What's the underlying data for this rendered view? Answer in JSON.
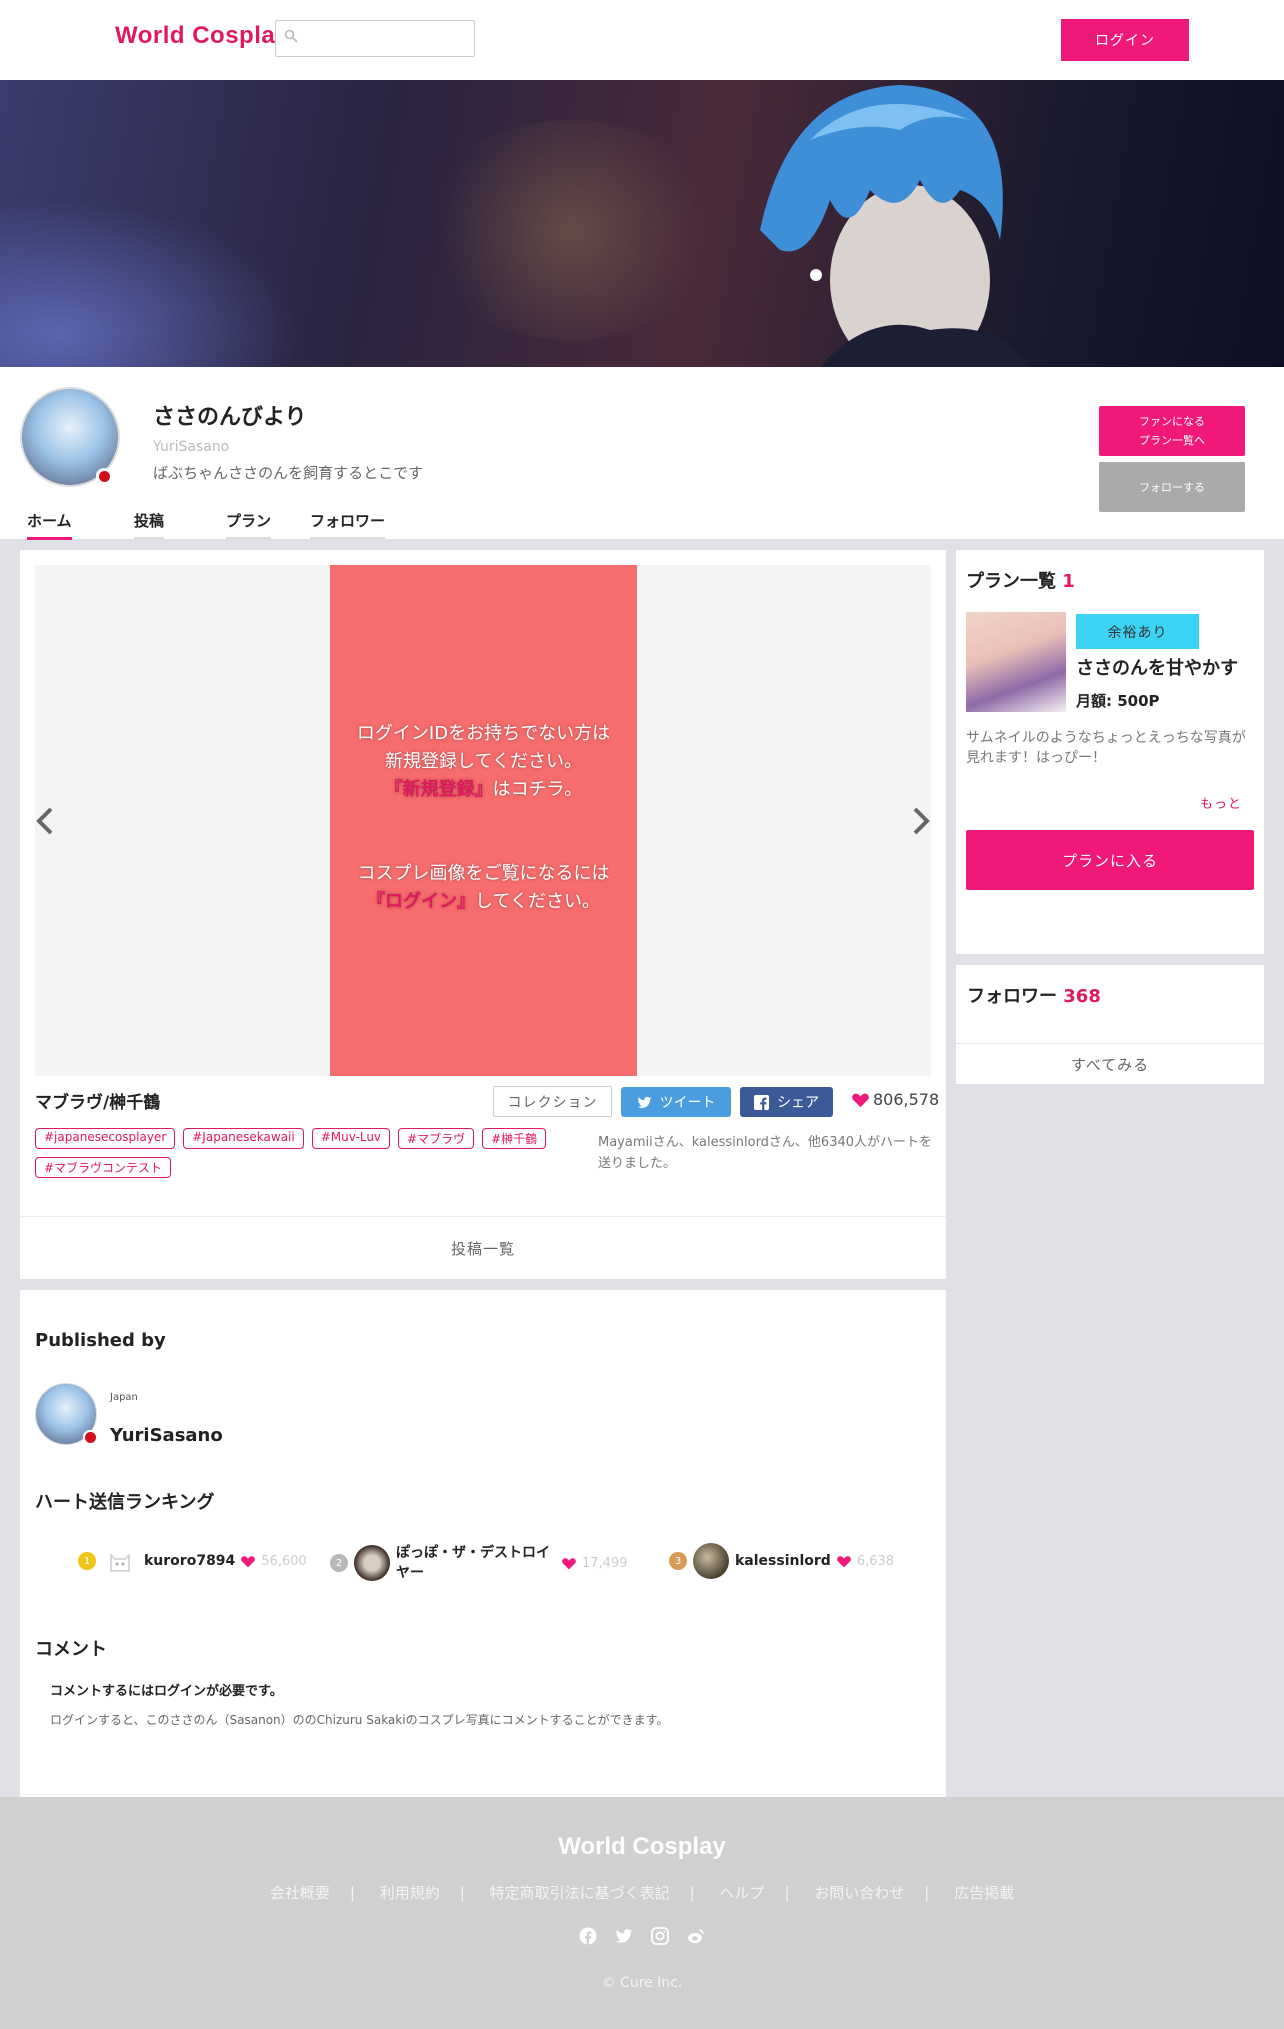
{
  "header": {
    "logo": "World Cosplay",
    "login_label": "ログイン"
  },
  "profile": {
    "display_name": "ささのんびより",
    "username": "YuriSasano",
    "description": "ばぶちゃんささのんを飼育するとこです",
    "fan_button_line1": "ファンになる",
    "fan_button_line2": "プラン一覧へ",
    "follow_label": "フォローする",
    "tabs": [
      {
        "label": "ホーム"
      },
      {
        "label": "投稿"
      },
      {
        "label": "プラン"
      },
      {
        "label": "フォロワー"
      }
    ]
  },
  "post": {
    "slide_line1": "ログインIDをお持ちでない方は",
    "slide_line2": "新規登録してください。",
    "slide_signup": "『新規登録』",
    "slide_line3": "はコチラ。",
    "slide_line4": "コスプレ画像をご覧になるには",
    "slide_login": "『ログイン』",
    "slide_line5": "してください。",
    "title": "マブラヴ/榊千鶴",
    "collection_label": "コレクション",
    "tweet_label": "ツイート",
    "share_label": "シェア",
    "heart_count": "806,578",
    "tags": [
      "#japanesecosplayer",
      "#Japanesekawaii",
      "#Muv-Luv",
      "#マブラヴ",
      "#榊千鶴",
      "#マブラヴコンテスト"
    ],
    "heart_note": "Mayamiiさん、kalessinlordさん、他6340人がハートを送りました。",
    "post_list_label": "投稿一覧"
  },
  "published": {
    "heading": "Published by",
    "country": "Japan",
    "username": "YuriSasano",
    "ranking_heading": "ハート送信ランキング",
    "ranking": [
      {
        "rank": "1",
        "name": "kuroro7894",
        "hearts": "56,600",
        "medal_color": "#f0c419"
      },
      {
        "rank": "2",
        "name": "ぽっぽ・ザ・デストロイヤー",
        "hearts": "17,499",
        "medal_color": "#b8b8b8"
      },
      {
        "rank": "3",
        "name": "kalessinlord",
        "hearts": "6,638",
        "medal_color": "#d99a55"
      }
    ],
    "comment_heading": "コメント",
    "comment_login_required": "コメントするにはログインが必要です。",
    "comment_note": "ログインすると、このささのん（Sasanon）ののChizuru Sakakiのコスプレ写真にコメントすることができます。"
  },
  "sidebar": {
    "plans_heading": "プラン一覧",
    "plans_count": "1",
    "plan_badge": "余裕あり",
    "plan_title": "ささのんを甘やかす",
    "plan_price": "月額: 500P",
    "plan_desc": "サムネイルのようなちょっとえっちな写真が見れます！はっぴー！",
    "more_label": "もっと",
    "join_label": "プランに入る",
    "followers_heading": "フォロワー",
    "followers_count": "368",
    "see_all_label": "すべてみる"
  },
  "footer": {
    "logo": "World Cosplay",
    "links": [
      "会社概要",
      "利用規約",
      "特定商取引法に基づく表記",
      "ヘルプ",
      "お問い合わせ",
      "広告掲載"
    ],
    "copyright": "© Cure Inc."
  },
  "colors": {
    "accent": "#f0197a",
    "brand": "#e0195f",
    "slide_bg": "#f76c6c",
    "twitter": "#4a9ee0",
    "facebook": "#3d5a98",
    "plan_badge": "#3cd4f5"
  }
}
